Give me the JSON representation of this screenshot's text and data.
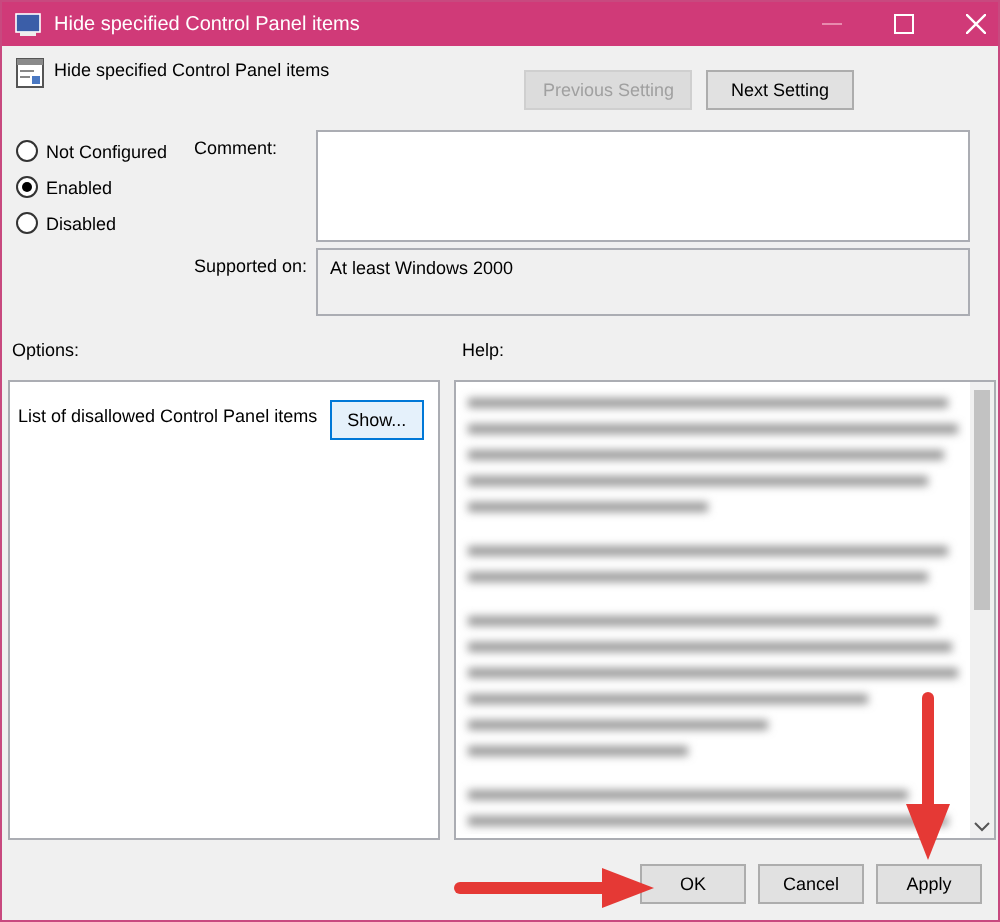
{
  "window": {
    "title": "Hide specified Control Panel items"
  },
  "header": {
    "title": "Hide specified Control Panel items"
  },
  "nav_buttons": [
    {
      "label": "Previous Setting",
      "disabled": true
    },
    {
      "label": "Next Setting",
      "disabled": false
    }
  ],
  "state_options": [
    {
      "label": "Not Configured",
      "selected": false
    },
    {
      "label": "Enabled",
      "selected": true
    },
    {
      "label": "Disabled",
      "selected": false
    }
  ],
  "comment": {
    "label": "Comment:"
  },
  "supported_on": {
    "label": "Supported on:",
    "value": "At least Windows 2000"
  },
  "options": {
    "label": "Options:",
    "items": [
      {
        "label": "List of disallowed Control Panel items",
        "button": "Show..."
      }
    ]
  },
  "help": {
    "label": "Help:"
  },
  "buttons": [
    {
      "label": "OK"
    },
    {
      "label": "Cancel"
    },
    {
      "label": "Apply"
    }
  ],
  "annotations": [
    {
      "kind": "arrow"
    },
    {
      "kind": "arrow"
    }
  ]
}
